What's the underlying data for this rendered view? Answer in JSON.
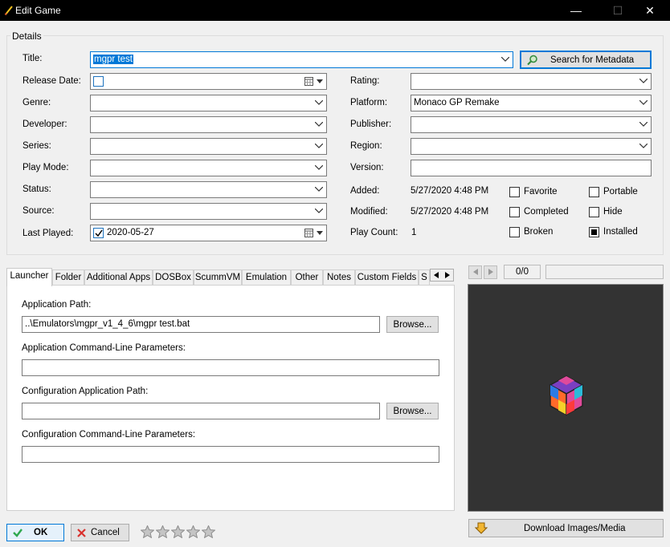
{
  "window": {
    "title": "Edit Game",
    "minimize": "—",
    "maximize": "☐",
    "close": "✕"
  },
  "details": {
    "group_label": "Details",
    "labels": {
      "title": "Title:",
      "release_date": "Release Date:",
      "genre": "Genre:",
      "developer": "Developer:",
      "series": "Series:",
      "play_mode": "Play Mode:",
      "status": "Status:",
      "source": "Source:",
      "last_played": "Last Played:",
      "rating": "Rating:",
      "platform": "Platform:",
      "publisher": "Publisher:",
      "region": "Region:",
      "version": "Version:",
      "added": "Added:",
      "modified": "Modified:",
      "play_count": "Play Count:"
    },
    "values": {
      "title": "mgpr test",
      "release_date": "",
      "genre": "",
      "developer": "",
      "series": "",
      "play_mode": "",
      "status": "",
      "source": "",
      "last_played": "2020-05-27",
      "rating": "",
      "platform": "Monaco GP Remake",
      "publisher": "",
      "region": "",
      "version": "",
      "added": "5/27/2020 4:48 PM",
      "modified": "5/27/2020 4:48 PM",
      "play_count": "1"
    },
    "search_metadata_label": "Search for Metadata",
    "flags": [
      {
        "label": "Favorite",
        "checked": false
      },
      {
        "label": "Portable",
        "checked": false
      },
      {
        "label": "Completed",
        "checked": false
      },
      {
        "label": "Hide",
        "checked": false
      },
      {
        "label": "Broken",
        "checked": false
      },
      {
        "label": "Installed",
        "checked": true
      }
    ]
  },
  "tabs": [
    {
      "label": "Launcher",
      "active": true
    },
    {
      "label": "Folder"
    },
    {
      "label": "Additional Apps"
    },
    {
      "label": "DOSBox"
    },
    {
      "label": "ScummVM"
    },
    {
      "label": "Emulation"
    },
    {
      "label": "Other"
    },
    {
      "label": "Notes"
    },
    {
      "label": "Custom Fields"
    },
    {
      "label": "S"
    }
  ],
  "launcher": {
    "app_path_label": "Application Path:",
    "app_path_value": "..\\Emulators\\mgpr_v1_4_6\\mgpr test.bat",
    "browse_label": "Browse...",
    "cmd_params_label": "Application Command-Line Parameters:",
    "cmd_params_value": "",
    "config_path_label": "Configuration Application Path:",
    "config_path_value": "",
    "config_browse_label": "Browse...",
    "config_cmd_label": "Configuration Command-Line Parameters:",
    "config_cmd_value": ""
  },
  "image_panel": {
    "counter": "0/0",
    "download_label": "Download Images/Media"
  },
  "footer": {
    "ok_label": "OK",
    "cancel_label": "Cancel",
    "rating_stars": 0,
    "rating_max": 5
  },
  "colors": {
    "accent": "#0078d7",
    "titlebar": "#000000",
    "image_bg": "#333333"
  }
}
